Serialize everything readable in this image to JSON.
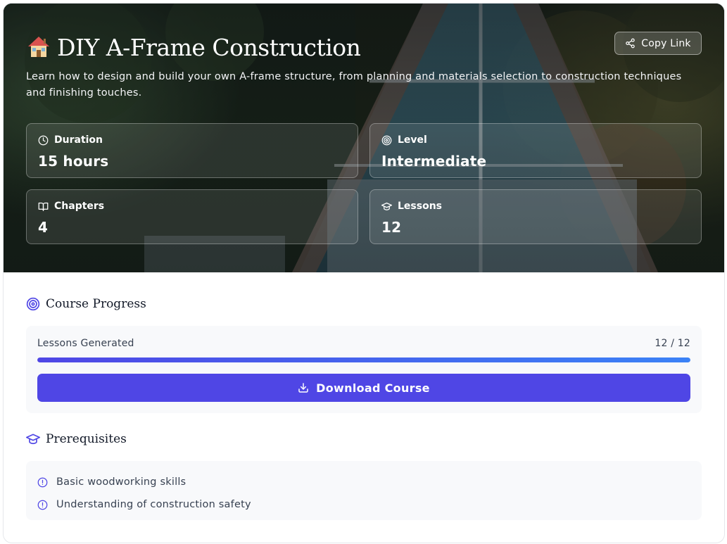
{
  "course": {
    "title": "DIY A-Frame Construction",
    "description": "Learn how to design and build your own A-frame structure, from planning and materials selection to construction techniques and finishing touches."
  },
  "actions": {
    "copy_link_label": "Copy Link",
    "download_label": "Download Course"
  },
  "stats": [
    {
      "label": "Duration",
      "value": "15 hours",
      "icon": "clock-icon"
    },
    {
      "label": "Level",
      "value": "Intermediate",
      "icon": "target-icon"
    },
    {
      "label": "Chapters",
      "value": "4",
      "icon": "book-open-icon"
    },
    {
      "label": "Lessons",
      "value": "12",
      "icon": "graduation-cap-icon"
    }
  ],
  "progress": {
    "section_title": "Course Progress",
    "label": "Lessons Generated",
    "count_text": "12 / 12",
    "fraction": 1.0
  },
  "prerequisites": {
    "section_title": "Prerequisites",
    "items": [
      "Basic woodworking skills",
      "Understanding of construction safety"
    ]
  },
  "colors": {
    "accent": "#4f46e5",
    "accent_light": "#3b82f6",
    "panel_bg": "#f8f9fb"
  }
}
